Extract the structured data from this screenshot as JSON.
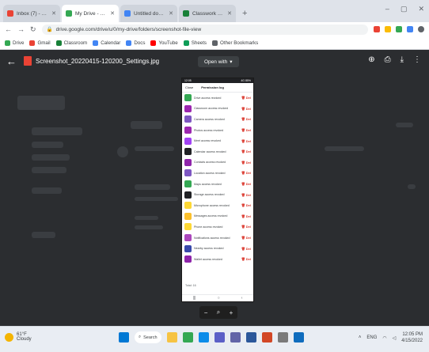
{
  "browser": {
    "tabs": [
      {
        "label": "Inbox (7) - student@gmail.com",
        "color": "#ea4335",
        "active": false
      },
      {
        "label": "My Drive - Google Drive",
        "color": "#34a853",
        "active": true
      },
      {
        "label": "Untitled document - Google Docs",
        "color": "#4285f4",
        "active": false
      },
      {
        "label": "Classwork - Assignments",
        "color": "#188038",
        "active": false
      }
    ],
    "new_tab": "+",
    "window_controls": [
      "–",
      "▢",
      "✕"
    ],
    "url": "drive.google.com/drive/u/0/my-drive/folders/screenshot-file-view",
    "bookmarks": [
      {
        "label": "Drive",
        "color": "#34a853"
      },
      {
        "label": "Gmail",
        "color": "#ea4335"
      },
      {
        "label": "Classroom",
        "color": "#188038"
      },
      {
        "label": "Calendar",
        "color": "#4285f4"
      },
      {
        "label": "Docs",
        "color": "#4285f4"
      },
      {
        "label": "YouTube",
        "color": "#ff0000"
      },
      {
        "label": "Sheets",
        "color": "#0f9d58"
      },
      {
        "label": "Other Bookmarks",
        "color": "#5f6368"
      }
    ]
  },
  "viewer": {
    "filename": "Screenshot_20220415-120200_Settings.jpg",
    "open_with": "Open with",
    "icons": [
      "add-to-drive-icon",
      "print-icon",
      "download-icon",
      "more-icon"
    ]
  },
  "phone": {
    "status_left": "12:05",
    "status_right": "4G 85%",
    "header_back": "Close",
    "header_title": "Permission log",
    "rows": [
      {
        "label": "Drive access revoked",
        "color": "#34a853"
      },
      {
        "label": "Classroom access revoked",
        "color": "#9c27b0"
      },
      {
        "label": "Camera access revoked",
        "color": "#7e57c2"
      },
      {
        "label": "Photos access revoked",
        "color": "#9c27b0"
      },
      {
        "label": "Meet access revoked",
        "color": "#a142f4"
      },
      {
        "label": "Calendar access revoked",
        "color": "#202124"
      },
      {
        "label": "Contacts access revoked",
        "color": "#8e24aa"
      },
      {
        "label": "Location access revoked",
        "color": "#7e57c2"
      },
      {
        "label": "Maps access revoked",
        "color": "#34a853"
      },
      {
        "label": "Storage access revoked",
        "color": "#202124"
      },
      {
        "label": "Microphone access revoked",
        "color": "#fdd835"
      },
      {
        "label": "Messages access revoked",
        "color": "#fbc02d"
      },
      {
        "label": "Phone access revoked",
        "color": "#fdd835"
      },
      {
        "label": "Notifications access revoked",
        "color": "#ab47bc"
      },
      {
        "label": "Nearby access revoked",
        "color": "#3949ab"
      },
      {
        "label": "Wallet access revoked",
        "color": "#8e24aa"
      }
    ],
    "delete_label": "Del",
    "footer": "Total: 16",
    "nav": [
      "|||",
      "○",
      "‹"
    ]
  },
  "zoom": {
    "out": "−",
    "zoom": "⌕",
    "in": "+"
  },
  "taskbar": {
    "weather_temp": "61°F",
    "weather_desc": "Cloudy",
    "search_label": "Search",
    "apps": [
      {
        "name": "start-icon",
        "color": "#0078d4"
      },
      {
        "name": "file-explorer-icon",
        "color": "#f6c343"
      },
      {
        "name": "chrome-icon",
        "color": "#34a853"
      },
      {
        "name": "edge-icon",
        "color": "#0c8ce9"
      },
      {
        "name": "store-icon",
        "color": "#5b5fc7"
      },
      {
        "name": "teams-icon",
        "color": "#6264a7"
      },
      {
        "name": "word-icon",
        "color": "#2b579a"
      },
      {
        "name": "powerpoint-icon",
        "color": "#d24726"
      },
      {
        "name": "settings-icon",
        "color": "#7a7a7a"
      },
      {
        "name": "photos-icon",
        "color": "#0f6cbd"
      }
    ],
    "tray_lang": "ENG",
    "time": "12:05 PM",
    "date": "4/15/2022"
  }
}
